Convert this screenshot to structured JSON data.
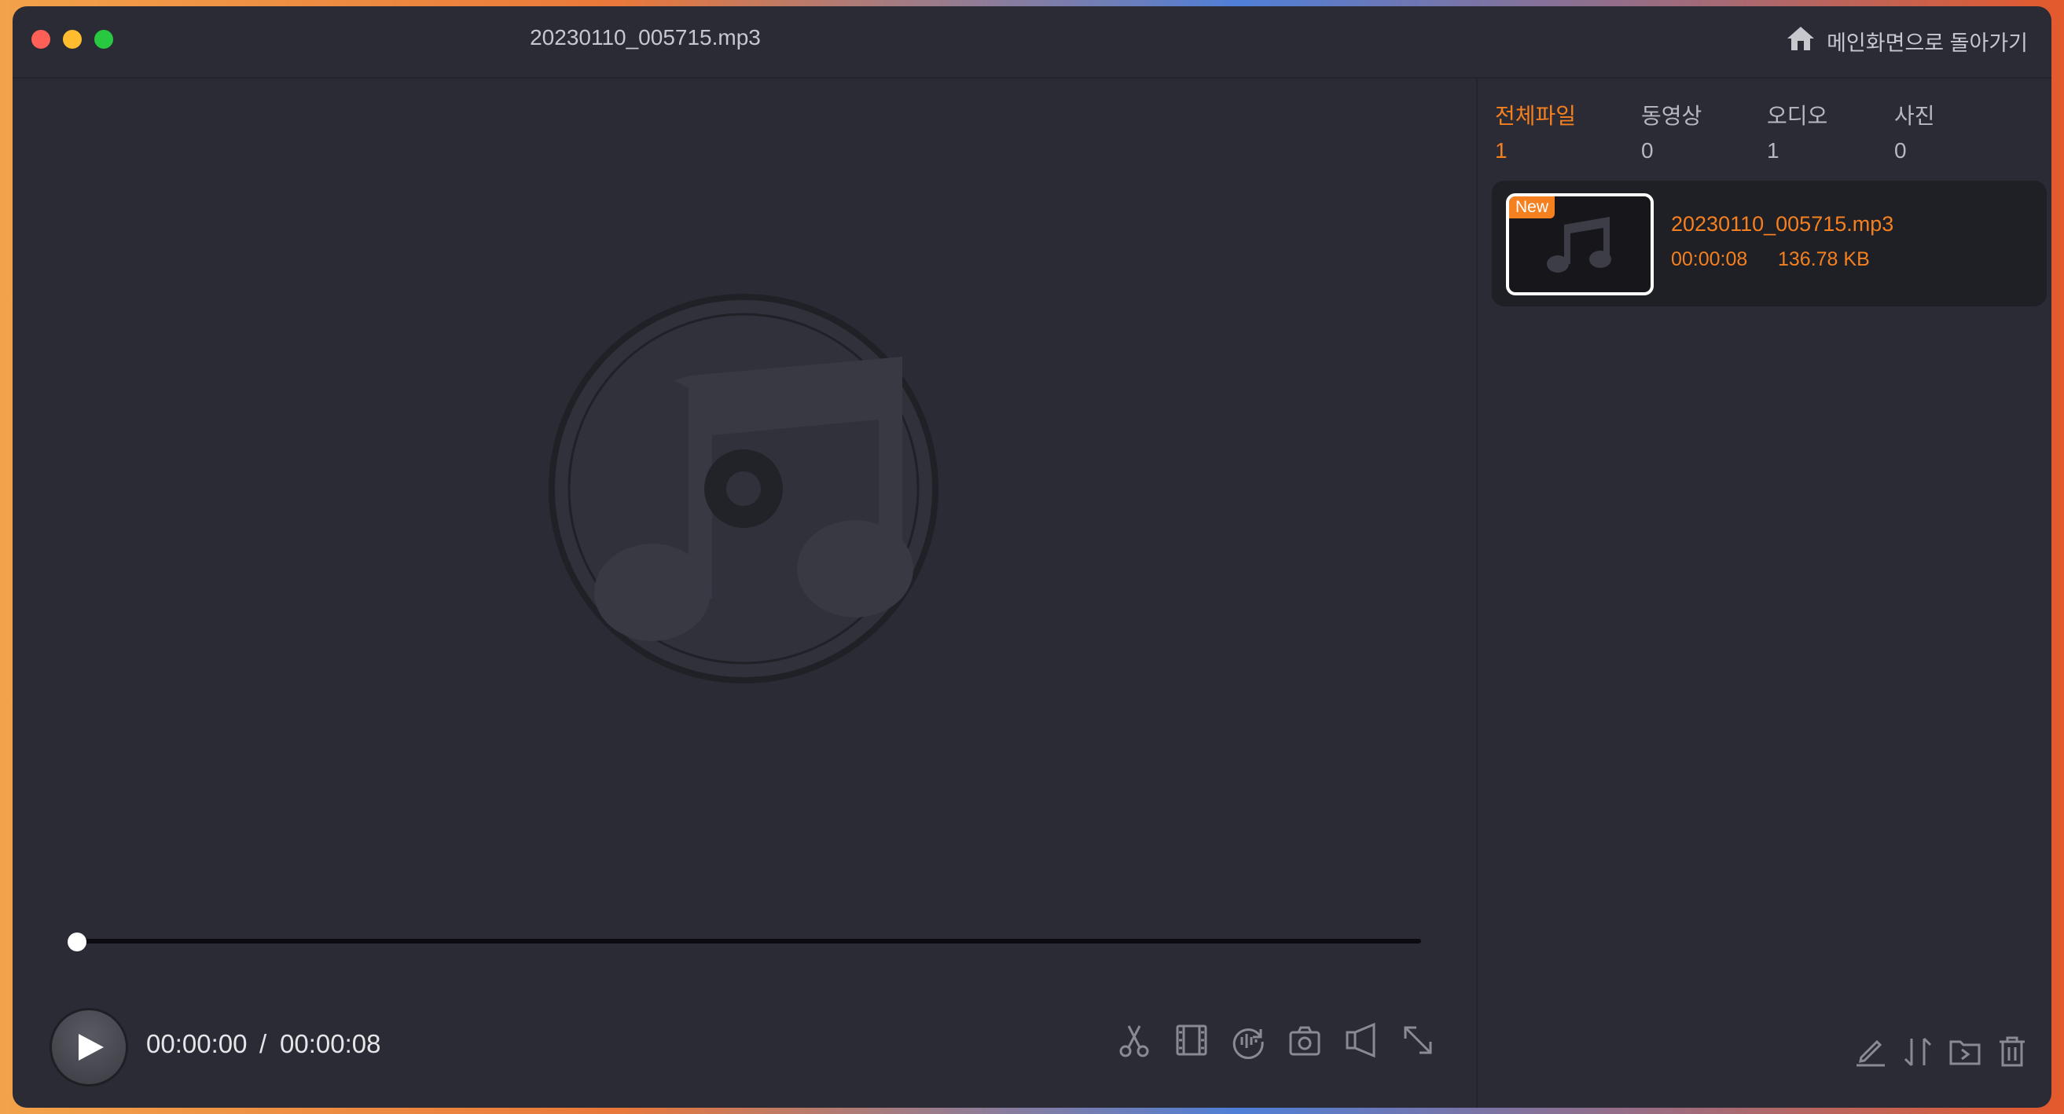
{
  "window": {
    "title": "20230110_005715.mp3",
    "home_label": "메인화면으로 돌아가기"
  },
  "player": {
    "current_time": "00:00:00",
    "separator": "/",
    "total_time": "00:00:08",
    "progress_fraction": 0,
    "controls": [
      "cut-icon",
      "film-strip-icon",
      "audio-loop-icon",
      "camera-icon",
      "speaker-icon",
      "fullscreen-icon"
    ]
  },
  "sidebar": {
    "tabs": [
      {
        "label": "전체파일",
        "count": "1"
      },
      {
        "label": "동영상",
        "count": "0"
      },
      {
        "label": "오디오",
        "count": "1"
      },
      {
        "label": "사진",
        "count": "0"
      }
    ],
    "files": [
      {
        "badge": "New",
        "name": "20230110_005715.mp3",
        "duration": "00:00:08",
        "size": "136.78 KB"
      }
    ],
    "actions": [
      "edit-icon",
      "sort-icon",
      "move-folder-icon",
      "delete-icon"
    ]
  },
  "colors": {
    "accent": "#f5801f",
    "window_bg": "#2b2b35",
    "card_bg": "#1f1f26"
  }
}
